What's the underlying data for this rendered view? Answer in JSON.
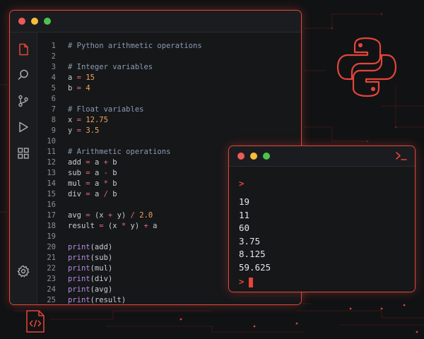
{
  "editor": {
    "lines": [
      {
        "n": "1",
        "t": [
          {
            "c": "cm",
            "v": "# Python arithmetic operations"
          }
        ]
      },
      {
        "n": "2",
        "t": []
      },
      {
        "n": "3",
        "t": [
          {
            "c": "cm",
            "v": "# Integer variables"
          }
        ]
      },
      {
        "n": "4",
        "t": [
          {
            "c": "",
            "v": "a "
          },
          {
            "c": "op",
            "v": "="
          },
          {
            "c": "",
            "v": " "
          },
          {
            "c": "num",
            "v": "15"
          }
        ]
      },
      {
        "n": "5",
        "t": [
          {
            "c": "",
            "v": "b "
          },
          {
            "c": "op",
            "v": "="
          },
          {
            "c": "",
            "v": " "
          },
          {
            "c": "num",
            "v": "4"
          }
        ]
      },
      {
        "n": "6",
        "t": []
      },
      {
        "n": "7",
        "t": [
          {
            "c": "cm",
            "v": "# Float variables"
          }
        ]
      },
      {
        "n": "8",
        "t": [
          {
            "c": "",
            "v": "x "
          },
          {
            "c": "op",
            "v": "="
          },
          {
            "c": "",
            "v": " "
          },
          {
            "c": "num",
            "v": "12.75"
          }
        ]
      },
      {
        "n": "9",
        "t": [
          {
            "c": "",
            "v": "y "
          },
          {
            "c": "op",
            "v": "="
          },
          {
            "c": "",
            "v": " "
          },
          {
            "c": "num",
            "v": "3.5"
          }
        ]
      },
      {
        "n": "10",
        "t": []
      },
      {
        "n": "11",
        "t": [
          {
            "c": "cm",
            "v": "# Arithmetic operations"
          }
        ]
      },
      {
        "n": "12",
        "t": [
          {
            "c": "",
            "v": "add "
          },
          {
            "c": "op",
            "v": "="
          },
          {
            "c": "",
            "v": " a "
          },
          {
            "c": "op",
            "v": "+"
          },
          {
            "c": "",
            "v": " b"
          }
        ]
      },
      {
        "n": "13",
        "t": [
          {
            "c": "",
            "v": "sub "
          },
          {
            "c": "op",
            "v": "="
          },
          {
            "c": "",
            "v": " a "
          },
          {
            "c": "op",
            "v": "-"
          },
          {
            "c": "",
            "v": " b"
          }
        ]
      },
      {
        "n": "14",
        "t": [
          {
            "c": "",
            "v": "mul "
          },
          {
            "c": "op",
            "v": "="
          },
          {
            "c": "",
            "v": " a "
          },
          {
            "c": "op",
            "v": "*"
          },
          {
            "c": "",
            "v": " b"
          }
        ]
      },
      {
        "n": "15",
        "t": [
          {
            "c": "",
            "v": "div "
          },
          {
            "c": "op",
            "v": "="
          },
          {
            "c": "",
            "v": " a "
          },
          {
            "c": "op",
            "v": "/"
          },
          {
            "c": "",
            "v": " b"
          }
        ]
      },
      {
        "n": "16",
        "t": []
      },
      {
        "n": "17",
        "t": [
          {
            "c": "",
            "v": "avg "
          },
          {
            "c": "op",
            "v": "="
          },
          {
            "c": "",
            "v": " (x "
          },
          {
            "c": "op",
            "v": "+"
          },
          {
            "c": "",
            "v": " y) "
          },
          {
            "c": "op",
            "v": "/"
          },
          {
            "c": "",
            "v": " "
          },
          {
            "c": "num",
            "v": "2.0"
          }
        ]
      },
      {
        "n": "18",
        "t": [
          {
            "c": "",
            "v": "result "
          },
          {
            "c": "op",
            "v": "="
          },
          {
            "c": "",
            "v": " (x "
          },
          {
            "c": "op",
            "v": "*"
          },
          {
            "c": "",
            "v": " y) "
          },
          {
            "c": "op",
            "v": "+"
          },
          {
            "c": "",
            "v": " a"
          }
        ]
      },
      {
        "n": "19",
        "t": []
      },
      {
        "n": "20",
        "t": [
          {
            "c": "fn",
            "v": "print"
          },
          {
            "c": "",
            "v": "(add)"
          }
        ]
      },
      {
        "n": "21",
        "t": [
          {
            "c": "fn",
            "v": "print"
          },
          {
            "c": "",
            "v": "(sub)"
          }
        ]
      },
      {
        "n": "22",
        "t": [
          {
            "c": "fn",
            "v": "print"
          },
          {
            "c": "",
            "v": "(mul)"
          }
        ]
      },
      {
        "n": "23",
        "t": [
          {
            "c": "fn",
            "v": "print"
          },
          {
            "c": "",
            "v": "(div)"
          }
        ]
      },
      {
        "n": "24",
        "t": [
          {
            "c": "fn",
            "v": "print"
          },
          {
            "c": "",
            "v": "(avg)"
          }
        ]
      },
      {
        "n": "25",
        "t": [
          {
            "c": "fn",
            "v": "print"
          },
          {
            "c": "",
            "v": "(result)"
          }
        ]
      }
    ]
  },
  "terminal": {
    "prompt": ">",
    "outputs": [
      "19",
      "11",
      "60",
      "3.75",
      "8.125",
      "59.625"
    ]
  },
  "icons": {
    "activity": [
      "file-icon",
      "search-icon",
      "source-control-icon",
      "run-icon",
      "extensions-icon"
    ],
    "bottom": "settings-icon",
    "terminal": "terminal-icon",
    "badge": "code-file-icon",
    "logo": "python-logo"
  },
  "colors": {
    "accent": "#e0483c",
    "number": "#f0a460",
    "operator": "#e06c75",
    "function": "#b58be8",
    "comment": "#8b9bb3"
  }
}
